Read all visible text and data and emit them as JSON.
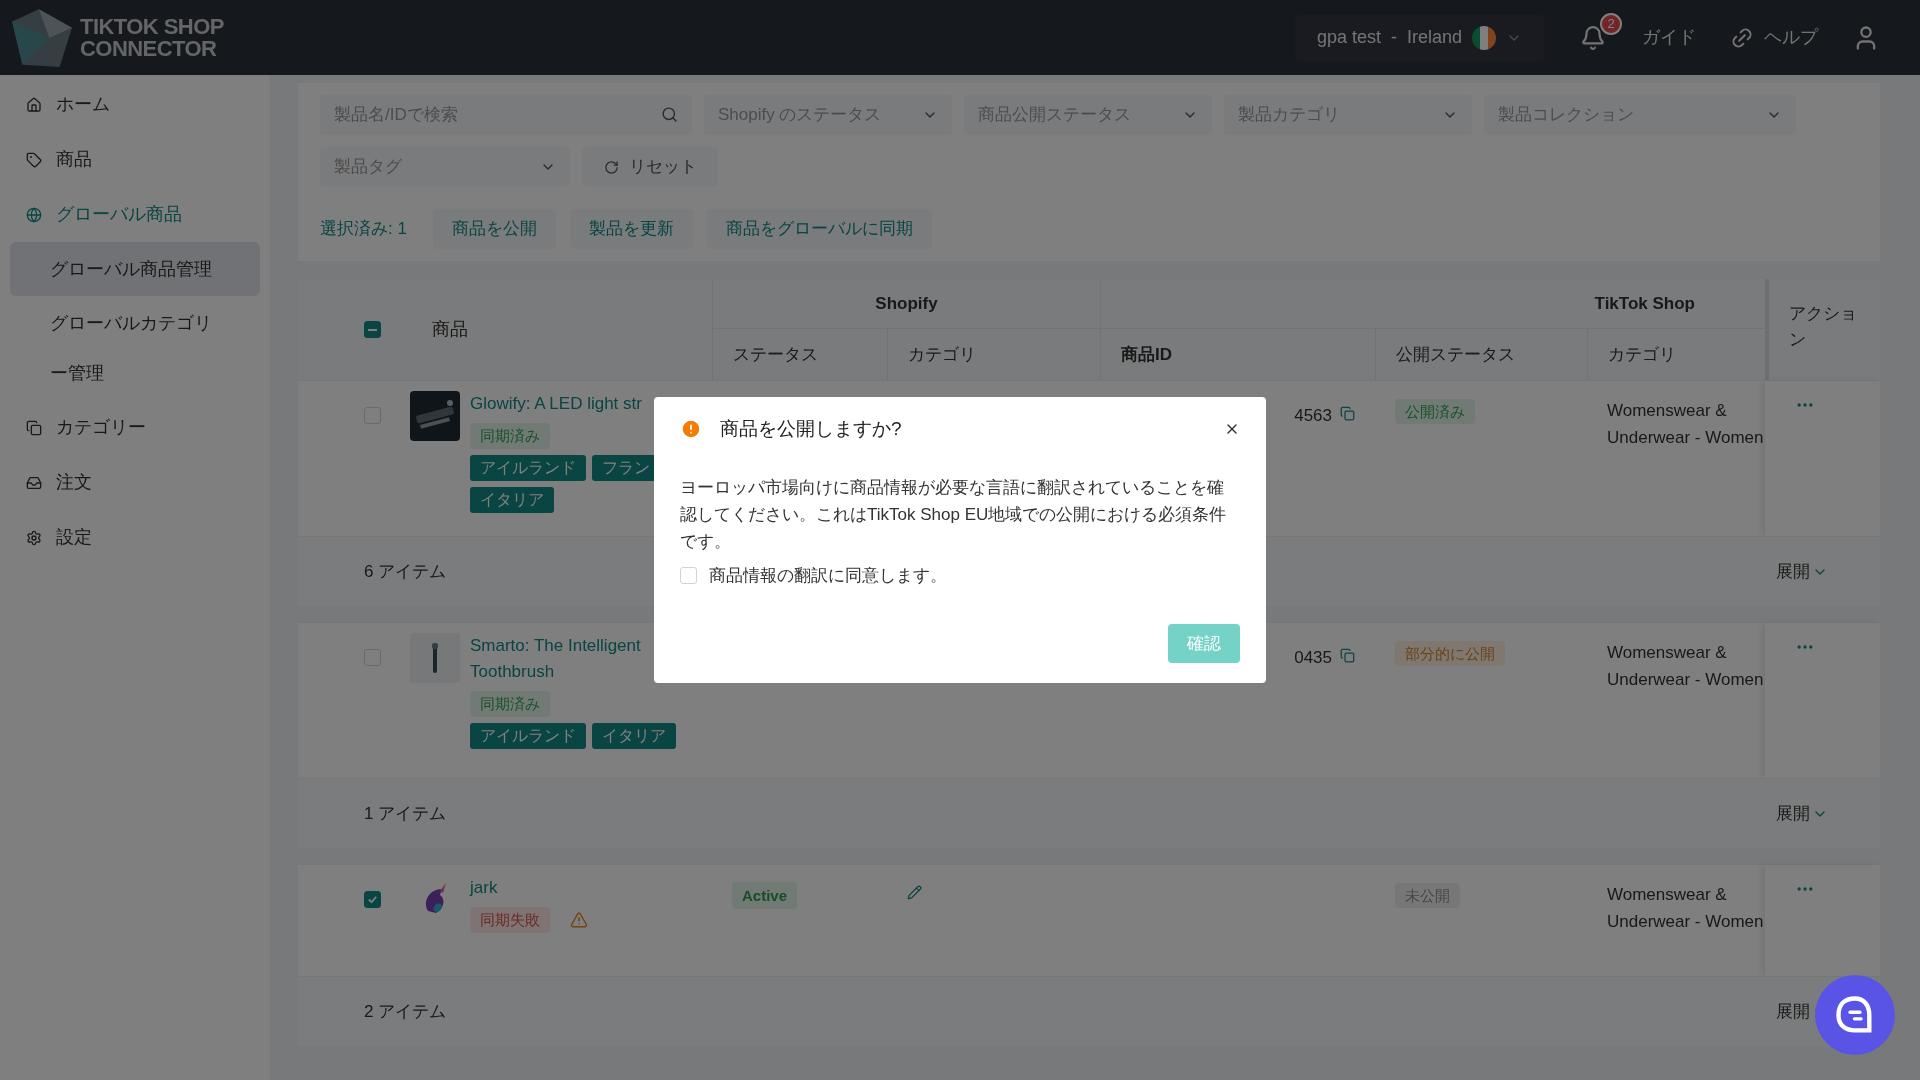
{
  "header": {
    "logo_lines": [
      "TIKTOK SHOP",
      "CONNECTOR"
    ],
    "store": "gpa test",
    "separator": "-",
    "country": "Ireland",
    "notification_count": "2",
    "links": [
      {
        "kind": "guide",
        "label": "ガイド"
      },
      {
        "kind": "help",
        "label": "ヘルプ"
      }
    ]
  },
  "sidebar": {
    "items": [
      {
        "kind": "home",
        "label": "ホーム",
        "selected": false
      },
      {
        "kind": "tag",
        "label": "商品",
        "selected": false
      },
      {
        "kind": "globe",
        "label": "グローバル商品",
        "selected": true,
        "children": [
          {
            "label": "グローバル商品管理",
            "selected": true
          },
          {
            "label": "グローバルカテゴリー管理",
            "selected": false
          }
        ]
      },
      {
        "kind": "copy",
        "label": "カテゴリー",
        "selected": false
      },
      {
        "kind": "inbox",
        "label": "注文",
        "selected": false
      },
      {
        "kind": "settings",
        "label": "設定",
        "selected": false
      }
    ]
  },
  "filters": {
    "search": {
      "placeholder": "製品名/IDで検索"
    },
    "selects": [
      {
        "placeholder": "Shopify のステータス"
      },
      {
        "placeholder": "商品公開ステータス"
      },
      {
        "placeholder": "製品カテゴリ"
      },
      {
        "placeholder": "製品コレクション"
      },
      {
        "placeholder": "製品タグ"
      }
    ],
    "reset": "リセット"
  },
  "bulk": {
    "selected_label": "選択済み: 1",
    "actions": [
      "商品を公開",
      "製品を更新",
      "商品をグローバルに同期"
    ]
  },
  "table": {
    "header_checkbox_indeterminate": true,
    "product_column": "商品",
    "groups": [
      "Shopify",
      "TikTok Shop"
    ],
    "columns": [
      "ステータス",
      "カテゴリ",
      "商品ID",
      "公開ステータス",
      "カテゴリ"
    ],
    "action_column": "アクション",
    "rows": [
      {
        "checked": false,
        "name": "Glowify: A LED light str",
        "sync": {
          "kind": "synced",
          "label": "同期済み"
        },
        "warning": false,
        "regions": [
          "アイルランド",
          "フラン",
          "イタリア"
        ],
        "shopify_status": "",
        "editable": false,
        "product_id": "4563",
        "copyable": true,
        "publish": {
          "kind": "published",
          "label": "公開済み"
        },
        "category": "Womenswear & Underwear - Women",
        "items": "6 アイテム",
        "expand": "展開"
      },
      {
        "checked": false,
        "name": "Smarto: The Intelligent Toothbrush",
        "sync": {
          "kind": "synced",
          "label": "同期済み"
        },
        "warning": false,
        "regions": [
          "アイルランド",
          "イタリア"
        ],
        "shopify_status": "",
        "editable": false,
        "product_id": "0435",
        "copyable": true,
        "publish": {
          "kind": "partial",
          "label": "部分的に公開"
        },
        "category": "Womenswear & Underwear - Women",
        "items": "1 アイテム",
        "expand": "展開"
      },
      {
        "checked": true,
        "name": "jark",
        "sync": {
          "kind": "failed",
          "label": "同期失敗"
        },
        "warning": true,
        "regions": [],
        "shopify_status": "Active",
        "editable": true,
        "product_id": "",
        "copyable": false,
        "publish": {
          "kind": "unpublished",
          "label": "未公開"
        },
        "category": "Womenswear & Underwear - Women",
        "items": "2 アイテム",
        "expand": "展開"
      }
    ]
  },
  "modal": {
    "title": "商品を公開しますか?",
    "body": "ヨーロッパ市場向けに商品情報が必要な言語に翻訳されていることを確認してください。これはTikTok Shop EU地域での公開における必須条件です。",
    "agree": {
      "label": "商品情報の翻訳に同意します。",
      "checked": false
    },
    "confirm": "確認"
  }
}
